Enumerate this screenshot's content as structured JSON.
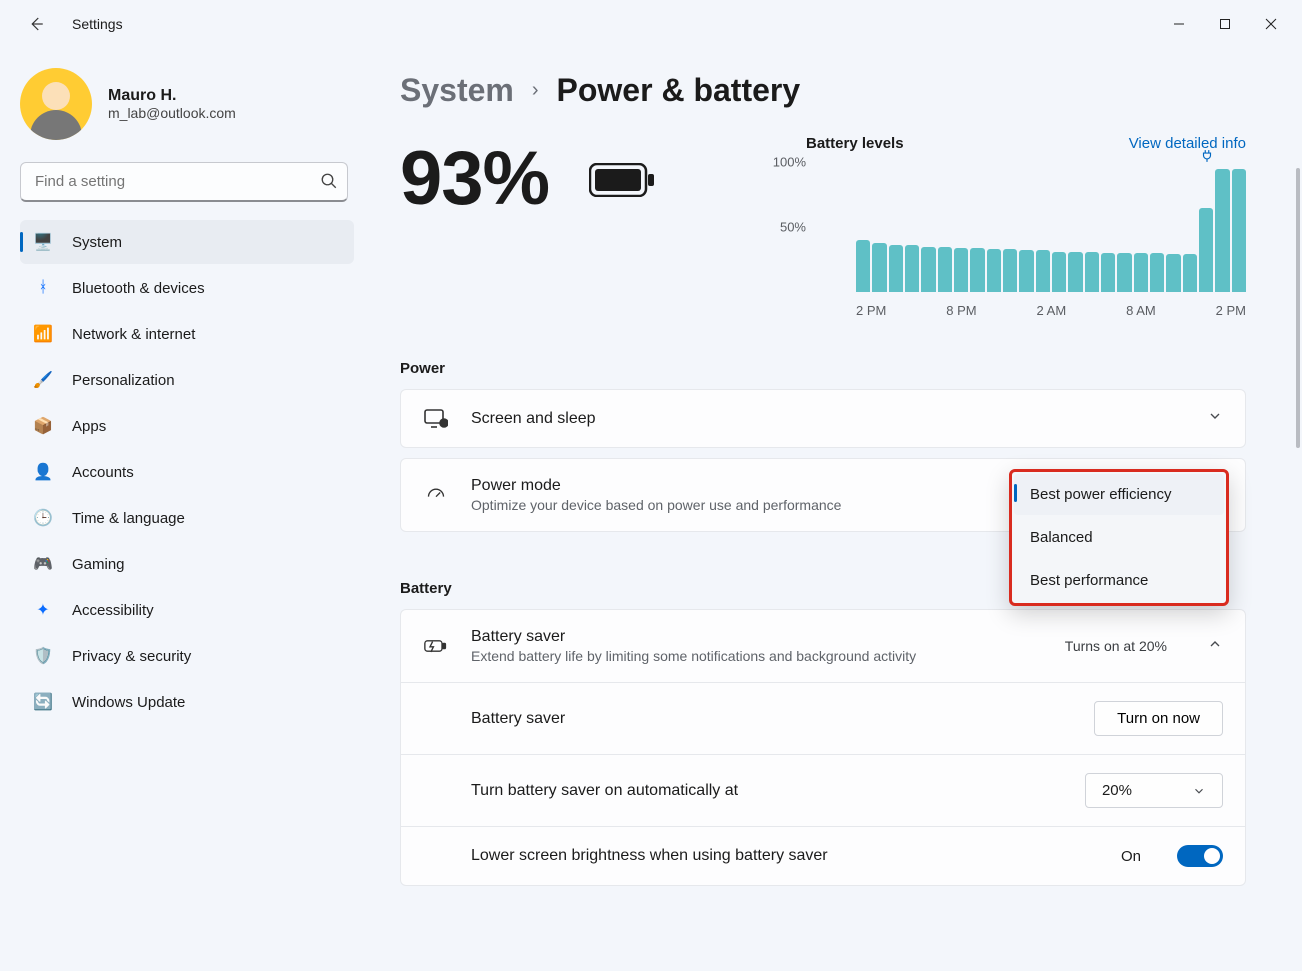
{
  "titlebar": {
    "app_title": "Settings"
  },
  "user": {
    "name": "Mauro H.",
    "email": "m_lab@outlook.com"
  },
  "search": {
    "placeholder": "Find a setting"
  },
  "nav": {
    "items": [
      {
        "label": "System"
      },
      {
        "label": "Bluetooth & devices"
      },
      {
        "label": "Network & internet"
      },
      {
        "label": "Personalization"
      },
      {
        "label": "Apps"
      },
      {
        "label": "Accounts"
      },
      {
        "label": "Time & language"
      },
      {
        "label": "Gaming"
      },
      {
        "label": "Accessibility"
      },
      {
        "label": "Privacy & security"
      },
      {
        "label": "Windows Update"
      }
    ]
  },
  "breadcrumb": {
    "parent": "System",
    "current": "Power & battery"
  },
  "hero": {
    "percent": "93%"
  },
  "chart_header": {
    "label": "Battery levels",
    "link": "View detailed info"
  },
  "chart_data": {
    "type": "bar",
    "ylabel": "",
    "ylim": [
      0,
      100
    ],
    "yticks": [
      "100%",
      "50%"
    ],
    "categories": [
      "2 PM",
      "8 PM",
      "2 AM",
      "8 AM",
      "2 PM"
    ],
    "values": [
      40,
      38,
      36,
      36,
      35,
      35,
      34,
      34,
      33,
      33,
      32,
      32,
      31,
      31,
      31,
      30,
      30,
      30,
      30,
      29,
      29,
      65,
      95,
      95
    ],
    "title": "Battery levels"
  },
  "sections": {
    "power_label": "Power",
    "battery_label": "Battery"
  },
  "rows": {
    "screen_sleep": "Screen and sleep",
    "power_mode_title": "Power mode",
    "power_mode_sub": "Optimize your device based on power use and performance",
    "battery_saver_title": "Battery saver",
    "battery_saver_sub": "Extend battery life by limiting some notifications and background activity",
    "battery_saver_status": "Turns on at 20%",
    "battery_saver_row": "Battery saver",
    "turn_on_now": "Turn on now",
    "auto_on_label": "Turn battery saver on automatically at",
    "auto_on_value": "20%",
    "lower_brightness": "Lower screen brightness when using battery saver",
    "lower_brightness_state": "On"
  },
  "dropdown": {
    "options": [
      "Best power efficiency",
      "Balanced",
      "Best performance"
    ]
  }
}
